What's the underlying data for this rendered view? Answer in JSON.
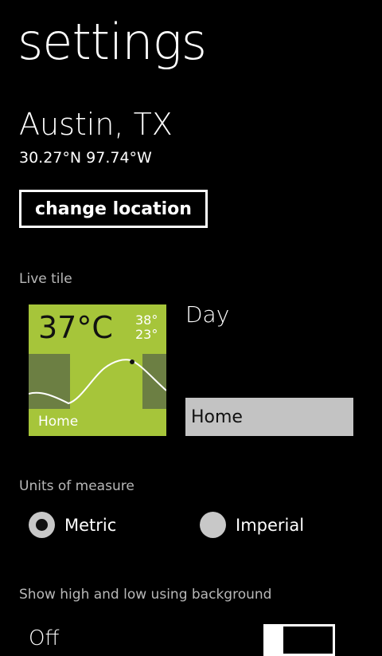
{
  "header": {
    "title": "settings"
  },
  "location": {
    "city": "Austin, TX",
    "coordinates": "30.27°N  97.74°W",
    "change_button": "change location"
  },
  "live_tile": {
    "section_label": "Live tile",
    "preview": {
      "temperature": "37°C",
      "high": "38°",
      "low": "23°",
      "name": "Home",
      "background_color": "#a6c53a"
    },
    "mode": "Day",
    "location_name": "Home"
  },
  "units": {
    "section_label": "Units of measure",
    "options": [
      {
        "label": "Metric",
        "selected": true
      },
      {
        "label": "Imperial",
        "selected": false
      }
    ]
  },
  "background": {
    "section_label": "Show high and low using background",
    "toggle_state": "Off",
    "toggle_on": false
  }
}
